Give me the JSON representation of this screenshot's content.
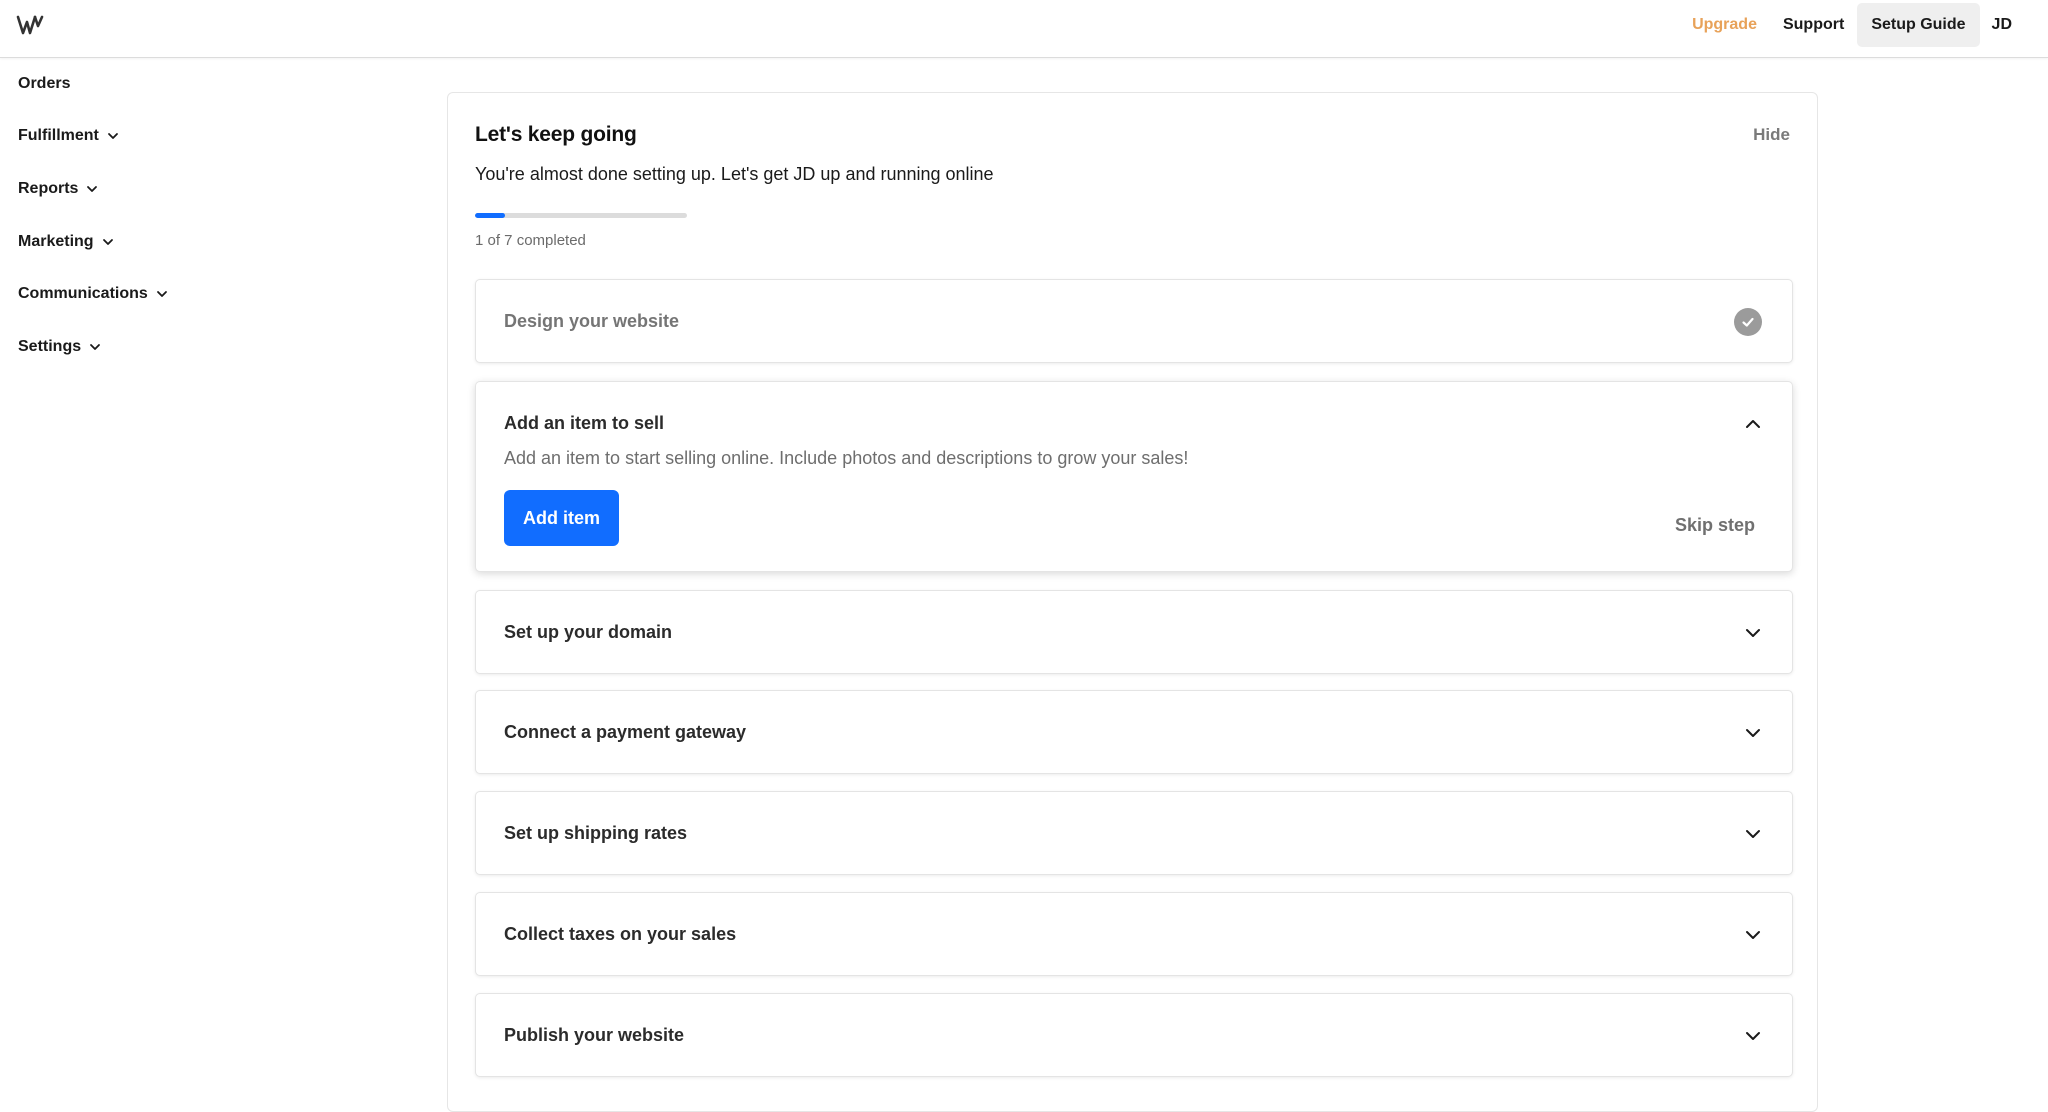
{
  "header": {
    "logo_icon": "wix-w-logo-icon",
    "nav": {
      "upgrade": "Upgrade",
      "support": "Support",
      "setup_guide": "Setup Guide",
      "avatar_initials": "JD"
    },
    "upgrade_color": "#e8a259"
  },
  "sidebar": {
    "items": [
      {
        "label": "Orders",
        "has_chevron": false
      },
      {
        "label": "Fulfillment",
        "has_chevron": true
      },
      {
        "label": "Reports",
        "has_chevron": true
      },
      {
        "label": "Marketing",
        "has_chevron": true
      },
      {
        "label": "Communications",
        "has_chevron": true
      },
      {
        "label": "Settings",
        "has_chevron": true
      }
    ]
  },
  "setup": {
    "title": "Let's keep going",
    "hide_label": "Hide",
    "subtitle": "You're almost done setting up. Let's get JD up and running online",
    "progress": {
      "completed": 1,
      "total": 7,
      "fraction": 0.14,
      "text": "1 of 7 completed"
    },
    "accent_color": "#116dff",
    "steps": [
      {
        "title": "Design your website",
        "state": "completed",
        "icon": "checkmark-circle-icon"
      },
      {
        "title": "Add an item to sell",
        "state": "expanded",
        "icon": "chevron-up-icon",
        "description": "Add an item to start selling online. Include photos and descriptions to grow your sales!",
        "primary_action": "Add item",
        "secondary_action": "Skip step"
      },
      {
        "title": "Set up your domain",
        "state": "collapsed",
        "icon": "chevron-down-icon"
      },
      {
        "title": "Connect a payment gateway",
        "state": "collapsed",
        "icon": "chevron-down-icon"
      },
      {
        "title": "Set up shipping rates",
        "state": "collapsed",
        "icon": "chevron-down-icon"
      },
      {
        "title": "Collect taxes on your sales",
        "state": "collapsed",
        "icon": "chevron-down-icon"
      },
      {
        "title": "Publish your website",
        "state": "collapsed",
        "icon": "chevron-down-icon"
      }
    ]
  }
}
